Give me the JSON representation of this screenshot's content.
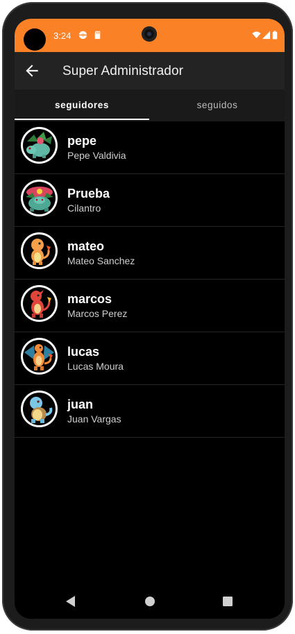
{
  "status_bar": {
    "time": "3:24",
    "background": "#fb8127",
    "left_icons": [
      "pokeball-notification-icon",
      "sd-card-icon"
    ],
    "right_icons": [
      "wifi-icon",
      "signal-icon",
      "battery-icon"
    ]
  },
  "app_bar": {
    "back_icon": "arrow-back-icon",
    "title": "Super Administrador"
  },
  "tabs": [
    {
      "label": "seguidores",
      "selected": true
    },
    {
      "label": "seguidos",
      "selected": false
    }
  ],
  "followers": [
    {
      "username": "pepe",
      "full_name": "Pepe Valdivia",
      "avatar": "ivysaur-icon"
    },
    {
      "username": "Prueba",
      "full_name": "Cilantro",
      "avatar": "venusaur-icon"
    },
    {
      "username": "mateo",
      "full_name": "Mateo Sanchez",
      "avatar": "charmander-icon"
    },
    {
      "username": "marcos",
      "full_name": "Marcos Perez",
      "avatar": "charmeleon-icon"
    },
    {
      "username": "lucas",
      "full_name": "Lucas Moura",
      "avatar": "charizard-icon"
    },
    {
      "username": "juan",
      "full_name": "Juan Vargas",
      "avatar": "squirtle-icon"
    }
  ],
  "nav_bar": {
    "buttons": [
      "back-triangle-icon",
      "home-circle-icon",
      "recents-square-icon"
    ]
  }
}
